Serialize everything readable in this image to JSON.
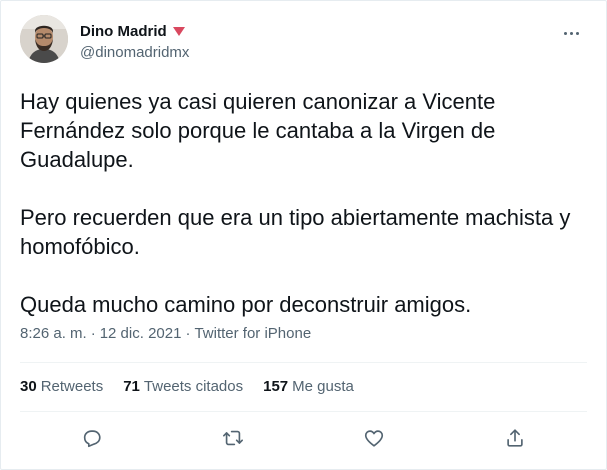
{
  "tweet": {
    "author": {
      "display_name": "Dino Madrid",
      "handle": "@dinomadridmx",
      "badge_icon": "triangle-down-icon",
      "badge_color": "#d9485f"
    },
    "paragraphs": [
      "Hay quienes ya casi quieren canonizar a Vicente Fernández solo porque le cantaba a la Virgen de Guadalupe.",
      "Pero recuerden que era un tipo abiertamente machista y homofóbico.",
      "Queda mucho camino por deconstruir amigos."
    ],
    "time": "8:26 a. m.",
    "date": "12 dic. 2021",
    "source": "Twitter for iPhone",
    "separator": "·"
  },
  "stats": {
    "retweets_count": "30",
    "retweets_label": "Retweets",
    "quotes_count": "71",
    "quotes_label": "Tweets citados",
    "likes_count": "157",
    "likes_label": "Me gusta"
  },
  "actions": [
    "reply-icon",
    "retweet-icon",
    "like-icon",
    "share-icon"
  ],
  "colors": {
    "text": "#0f1419",
    "secondary": "#536471",
    "divider": "#eff3f4"
  }
}
